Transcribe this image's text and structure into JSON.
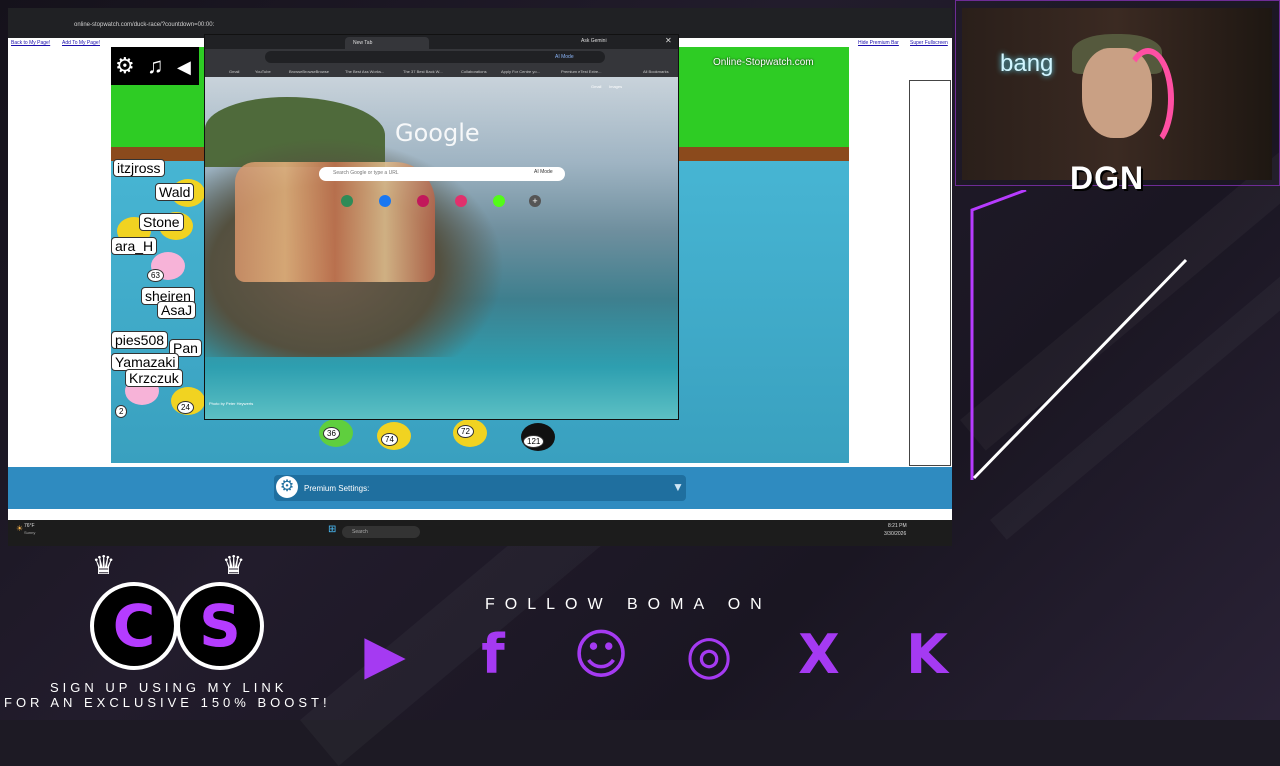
{
  "browser": {
    "url": "online-stopwatch.com/duck-race/?countdown=00:00:",
    "links": {
      "back": "Back to My Page!",
      "add": "Add To My Page!",
      "hide_bar": "Hide Premium Bar",
      "super_fullscreen": "Super Fullscreen"
    }
  },
  "game": {
    "logo_text": "Online-Stopwatch.com",
    "duck_labels": [
      "itzjross",
      "Wald",
      "Stone",
      "ara_H",
      "sheiren",
      "AsaJ",
      "pies508",
      "Pan",
      "Yamazaki",
      "Krzczuk"
    ],
    "badges": [
      "63",
      "2",
      "24",
      "36",
      "74",
      "72",
      "121"
    ]
  },
  "premium": {
    "label": "Premium Settings:"
  },
  "chrome": {
    "tab_title": "New Tab",
    "ask_gemini": "Ask Gemini",
    "ai_mode": "AI Mode",
    "bookmarks": [
      "Gmail",
      "YouTube",
      "BrowseBrowseBrowse",
      "The Best Ass Works...",
      "The 37 Best Back W...",
      "Collaborations",
      "Apply For Centre yo...",
      "Premium eTest Extre...",
      "All Bookmarks"
    ],
    "top_links": [
      "Gmail",
      "Images"
    ],
    "google_logo": "Google",
    "search_placeholder": "Search Google or type a URL",
    "photo_credit": "Photo by Peter Heywerts"
  },
  "taskbar": {
    "search": "Search",
    "weather": "76°F",
    "weather_sub": "Sunny",
    "time": "8:21 PM",
    "date": "3/30/2026"
  },
  "overlay": {
    "brand_c": "C",
    "brand_s": "S",
    "signup_line1": "SIGN UP USING MY LINK",
    "signup_line2": "FOR AN EXCLUSIVE 150% BOOST!",
    "follow": "FOLLOW BOMA ON",
    "cam_tag": "DGN",
    "bang_tag": "bang",
    "socials": [
      "youtube-icon",
      "facebook-icon",
      "discord-icon",
      "instagram-icon",
      "x-icon",
      "kick-icon"
    ],
    "accent_color": "#a53af2"
  }
}
